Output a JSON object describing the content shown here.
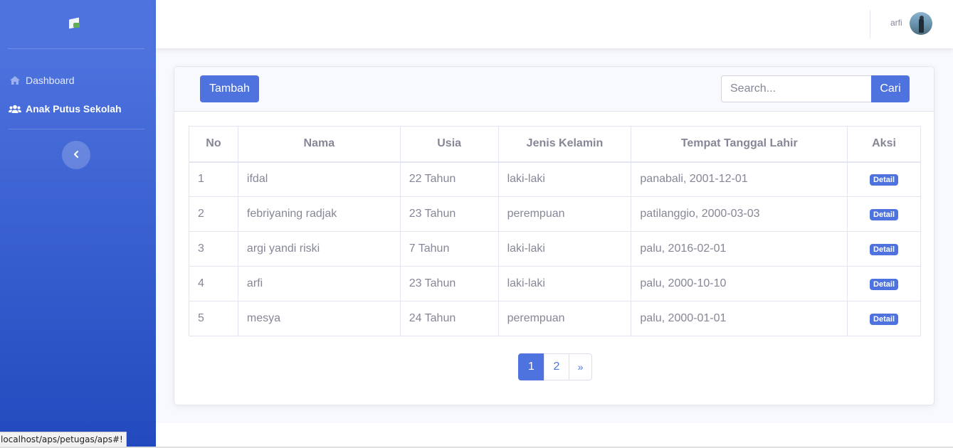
{
  "sidebar": {
    "items": [
      {
        "label": "Dashboard",
        "icon": "home-icon"
      },
      {
        "label": "Anak Putus Sekolah",
        "icon": "users-icon"
      }
    ]
  },
  "topbar": {
    "username": "arfi"
  },
  "toolbar": {
    "add_label": "Tambah",
    "search_placeholder": "Search...",
    "search_button": "Cari"
  },
  "table": {
    "headers": [
      "No",
      "Nama",
      "Usia",
      "Jenis Kelamin",
      "Tempat Tanggal Lahir",
      "Aksi"
    ],
    "rows": [
      {
        "no": "1",
        "nama": "ifdal",
        "usia": "22 Tahun",
        "jk": "laki-laki",
        "ttl": "panabali, 2001-12-01",
        "aksi": "Detail"
      },
      {
        "no": "2",
        "nama": "febriyaning radjak",
        "usia": "23 Tahun",
        "jk": "perempuan",
        "ttl": "patilanggio, 2000-03-03",
        "aksi": "Detail"
      },
      {
        "no": "3",
        "nama": "argi yandi riski",
        "usia": "7 Tahun",
        "jk": "laki-laki",
        "ttl": "palu, 2016-02-01",
        "aksi": "Detail"
      },
      {
        "no": "4",
        "nama": "arfi",
        "usia": "23 Tahun",
        "jk": "laki-laki",
        "ttl": "palu, 2000-10-10",
        "aksi": "Detail"
      },
      {
        "no": "5",
        "nama": "mesya",
        "usia": "24 Tahun",
        "jk": "perempuan",
        "ttl": "palu, 2000-01-01",
        "aksi": "Detail"
      }
    ]
  },
  "pagination": {
    "pages": [
      "1",
      "2"
    ],
    "next": "»",
    "current": "1"
  },
  "status_url": "localhost/aps/petugas/aps#!",
  "colors": {
    "primary": "#4e73df",
    "text": "#858796"
  }
}
